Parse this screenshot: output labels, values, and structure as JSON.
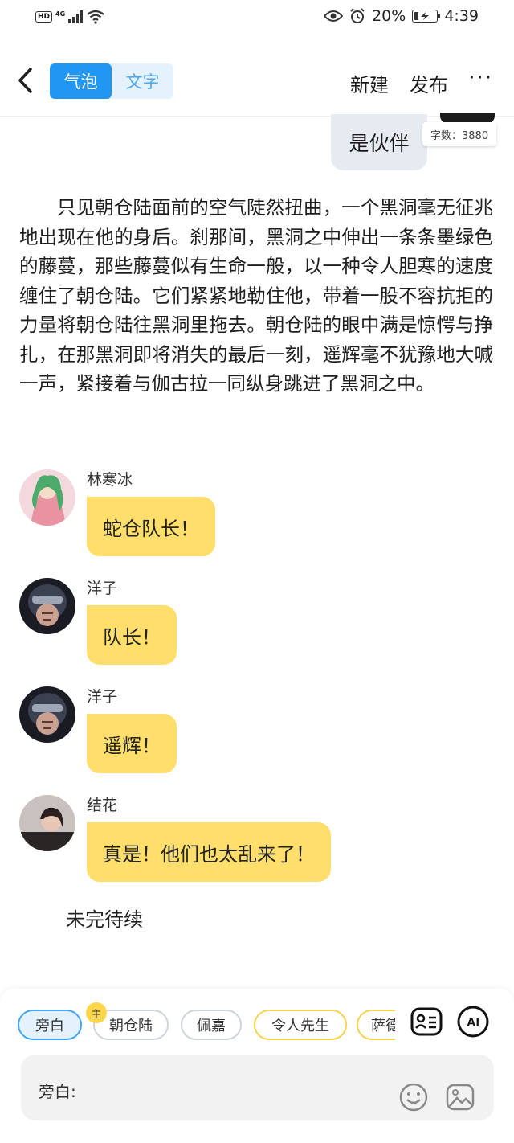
{
  "status_bar": {
    "hd": "HD",
    "network": "4G",
    "battery_percent": "20%",
    "battery_level": 0.2,
    "time": "4:39"
  },
  "nav": {
    "tabs": [
      "气泡",
      "文字"
    ],
    "active_tab": 0,
    "new_label": "新建",
    "publish_label": "发布",
    "more_label": "···"
  },
  "top_message": {
    "text": "是伙伴",
    "word_count": "字数：3880"
  },
  "narration": "只见朝仓陆面前的空气陡然扭曲，一个黑洞毫无征兆地出现在他的身后。刹那间，黑洞之中伸出一条条墨绿色的藤蔓，那些藤蔓似有生命一般，以一种令人胆寒的速度缠住了朝仓陆。它们紧紧地勒住他，带着一股不容抗拒的力量将朝仓陆往黑洞里拖去。朝仓陆的眼中满是惊愕与挣扎，在那黑洞即将消失的最后一刻，遥辉毫不犹豫地大喊一声，紧接着与伽古拉一同纵身跳进了黑洞之中。",
  "messages": [
    {
      "sender": "林寒冰",
      "text": "蛇仓队长！"
    },
    {
      "sender": "洋子",
      "text": "队长！"
    },
    {
      "sender": "洋子",
      "text": "遥辉！"
    },
    {
      "sender": "结花",
      "text": "真是！他们也太乱来了！"
    }
  ],
  "ending": "未完待续",
  "roles": [
    "旁白",
    "朝仓陆",
    "佩嘉",
    "令人先生",
    "萨德"
  ],
  "main_badge": "主",
  "selected_role": 0,
  "input": {
    "label": "旁白:"
  },
  "colors": {
    "accent": "#2196f3",
    "bubble": "#ffde6b",
    "tab_bg": "#e3f2fd"
  }
}
